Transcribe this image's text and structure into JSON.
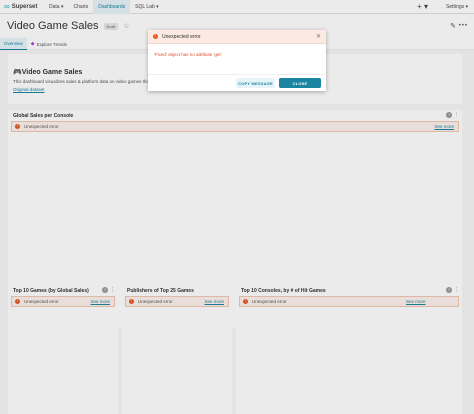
{
  "navbar": {
    "brand": "Superset",
    "items": [
      {
        "label": "Data ▾",
        "active": false
      },
      {
        "label": "Charts",
        "active": false
      },
      {
        "label": "Dashboards",
        "active": true
      },
      {
        "label": "SQL Lab ▾",
        "active": false
      }
    ],
    "plus": "+ ▾",
    "settings": "Settings ▾"
  },
  "header": {
    "title": "Video Game Sales",
    "badge": "Draft"
  },
  "tabs": [
    {
      "label": "Overview",
      "active": true
    },
    {
      "label": "Explore Trends",
      "active": false
    }
  ],
  "markdown": {
    "title": "🎮Video Game Sales",
    "text": "This dashboard visualizes sales & platform data on video games tha",
    "link": "Original dataset"
  },
  "charts": [
    {
      "title": "Global Sales per Console",
      "error": "Unexpected error",
      "see_more": "See more"
    },
    {
      "title": "Top 10 Games (by Global Sales)",
      "error": "Unexpected error",
      "see_more": "See more"
    },
    {
      "title": "Publishers of Top 25 Games",
      "error": "Unexpected error",
      "see_more": "See more"
    },
    {
      "title": "Top 10 Consoles, by # of Hit Games",
      "error": "Unexpected error",
      "see_more": "See more"
    }
  ],
  "modal": {
    "title": "Unexpected error",
    "message": "'Fixed' object has no attribute 'get'",
    "copy_label": "COPY MESSAGE",
    "close_label": "CLOSE"
  },
  "colors": {
    "accent": "#1a85a0",
    "error": "#e05a2b"
  }
}
